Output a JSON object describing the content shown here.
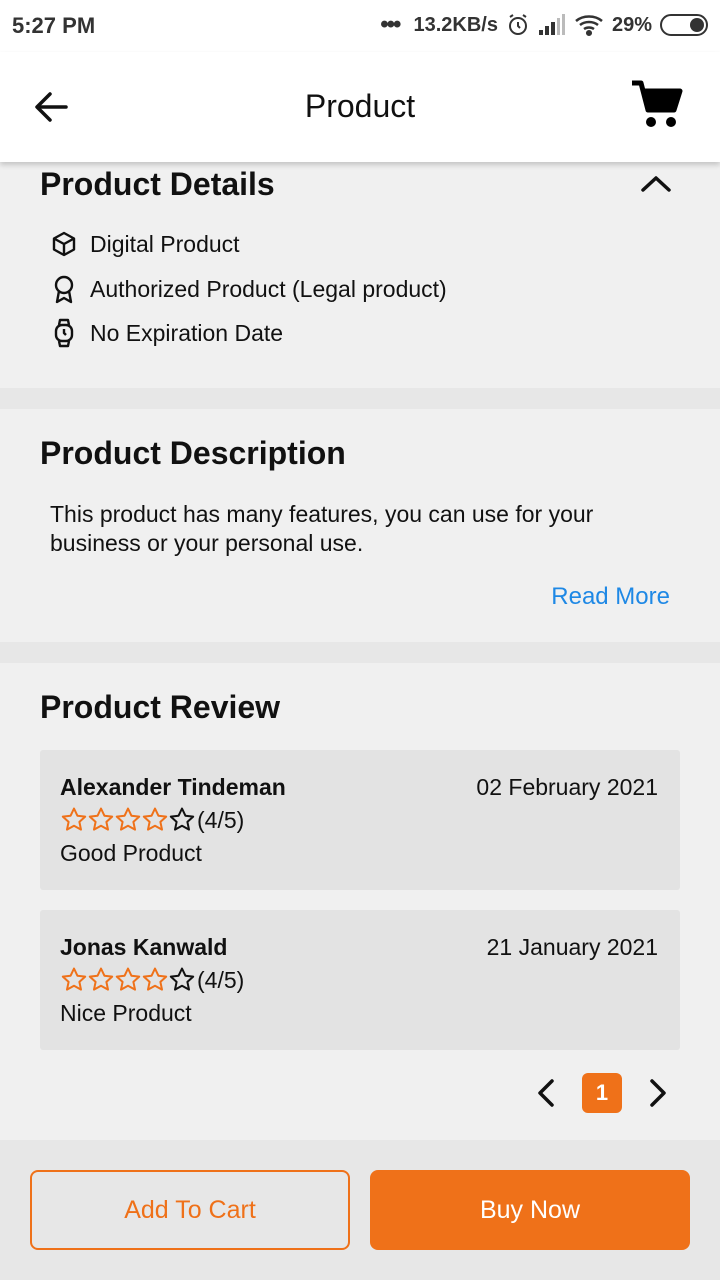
{
  "status_bar": {
    "time": "5:27 PM",
    "network_speed": "13.2KB/s",
    "battery": "29%",
    "icons": [
      "more-dots-icon",
      "alarm-icon",
      "signal-icon",
      "wifi-icon",
      "battery-icon"
    ]
  },
  "app_bar": {
    "title": "Product",
    "back_icon": "arrow-left-icon",
    "cart_icon": "shopping-cart-icon"
  },
  "product_details": {
    "title": "Product Details",
    "toggle_icon": "chevron-up-icon",
    "items": [
      {
        "label": "Digital Product",
        "icon": "cube-icon"
      },
      {
        "label": "Authorized Product (Legal product)",
        "icon": "award-icon"
      },
      {
        "label": "No Expiration Date",
        "icon": "watch-icon"
      }
    ]
  },
  "product_description": {
    "title": "Product Description",
    "text": "This product has many features, you can use for your business or your personal use.",
    "read_more": "Read More"
  },
  "product_review": {
    "title": "Product Review",
    "reviews": [
      {
        "name": "Alexander Tindeman",
        "date": "02 February 2021",
        "rating": 4,
        "max_rating": 5,
        "rating_text": "(4/5)",
        "comment": "Good Product"
      },
      {
        "name": "Jonas Kanwald",
        "date": "21 January 2021",
        "rating": 4,
        "max_rating": 5,
        "rating_text": "(4/5)",
        "comment": "Nice Product"
      }
    ],
    "pagination": {
      "current_page": "1",
      "prev_icon": "chevron-left-icon",
      "next_icon": "chevron-right-icon"
    }
  },
  "actions": {
    "add_to_cart": "Add To Cart",
    "buy_now": "Buy Now"
  },
  "colors": {
    "accent": "#ef7119",
    "link": "#1e88e5",
    "star_empty": "#111111"
  }
}
